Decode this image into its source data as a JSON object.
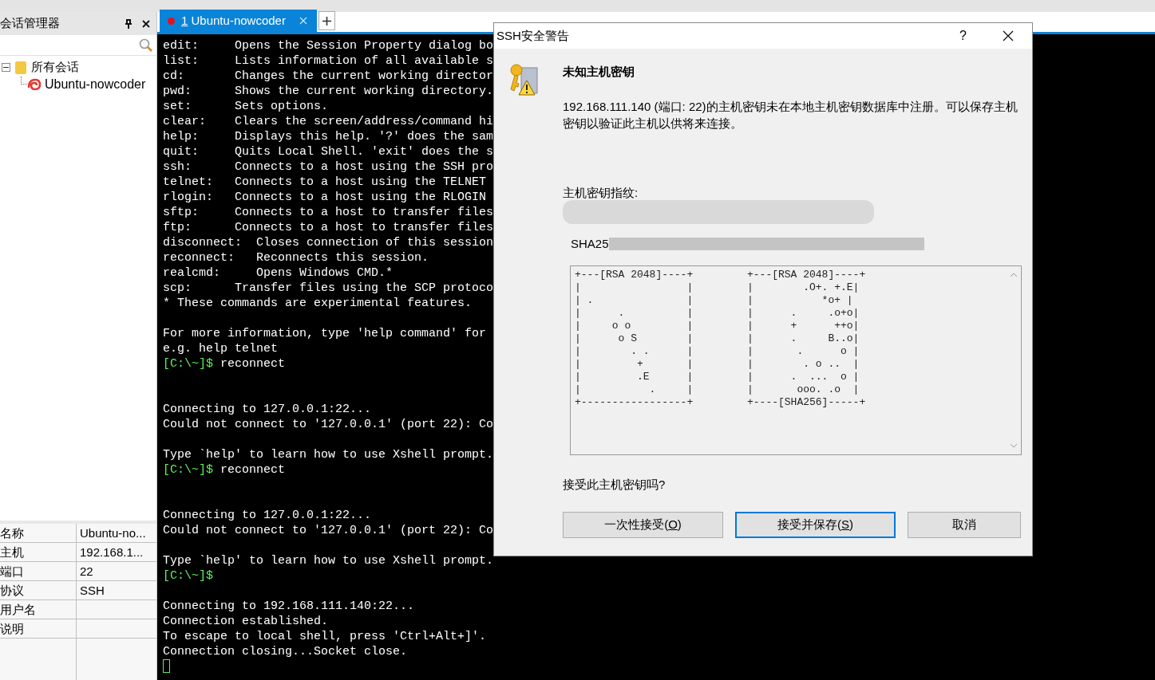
{
  "session_manager": {
    "title": "会话管理器",
    "tree": [
      {
        "label": "所有会话",
        "expanded": true,
        "children": [
          {
            "label": "Ubuntu-nowcoder"
          }
        ]
      }
    ],
    "properties": [
      {
        "name": "名称",
        "value": "Ubuntu-no..."
      },
      {
        "name": "主机",
        "value": "192.168.1..."
      },
      {
        "name": "端口",
        "value": "22"
      },
      {
        "name": "协议",
        "value": "SSH"
      },
      {
        "name": "用户名"
      },
      {
        "name": "说明"
      }
    ]
  },
  "tabs": [
    {
      "number": "1",
      "label": "Ubuntu-nowcoder",
      "selected": true
    }
  ],
  "terminal": {
    "lines": [
      {
        "text": "edit:     Opens the Session Property dialog bo"
      },
      {
        "text": "list:     Lists information of all available s"
      },
      {
        "text": "cd:       Changes the current working director"
      },
      {
        "text": "pwd:      Shows the current working directory."
      },
      {
        "text": "set:      Sets options."
      },
      {
        "text": "clear:    Clears the screen/address/command hi"
      },
      {
        "text": "help:     Displays this help. '?' does the sam"
      },
      {
        "text": "quit:     Quits Local Shell. 'exit' does the s"
      },
      {
        "text": "ssh:      Connects to a host using the SSH pro"
      },
      {
        "text": "telnet:   Connects to a host using the TELNET"
      },
      {
        "text": "rlogin:   Connects to a host using the RLOGIN"
      },
      {
        "text": "sftp:     Connects to a host to transfer files"
      },
      {
        "text": "ftp:      Connects to a host to transfer files"
      },
      {
        "text": "disconnect:  Closes connection of this session"
      },
      {
        "text": "reconnect:   Reconnects this session."
      },
      {
        "text": "realcmd:     Opens Windows CMD.*"
      },
      {
        "text": "scp:      Transfer files using the SCP protoco"
      },
      {
        "text": "* These commands are experimental features."
      },
      {
        "kind": "blank"
      },
      {
        "text": "For more information, type 'help command' for"
      },
      {
        "text": "e.g. help telnet"
      },
      {
        "prompt": "[C:\\~]$",
        "text": " reconnect"
      },
      {
        "kind": "blank"
      },
      {
        "kind": "blank"
      },
      {
        "text": "Connecting to 127.0.0.1:22..."
      },
      {
        "text": "Could not connect to '127.0.0.1' (port 22): Co"
      },
      {
        "kind": "blank"
      },
      {
        "text": "Type `help' to learn how to use Xshell prompt."
      },
      {
        "prompt": "[C:\\~]$",
        "text": " reconnect"
      },
      {
        "kind": "blank"
      },
      {
        "kind": "blank"
      },
      {
        "text": "Connecting to 127.0.0.1:22..."
      },
      {
        "text": "Could not connect to '127.0.0.1' (port 22): Co"
      },
      {
        "kind": "blank"
      },
      {
        "text": "Type `help' to learn how to use Xshell prompt."
      },
      {
        "prompt": "[C:\\~]$"
      },
      {
        "kind": "blank"
      },
      {
        "text": "Connecting to 192.168.111.140:22..."
      },
      {
        "text": "Connection established."
      },
      {
        "text": "To escape to local shell, press 'Ctrl+Alt+]'."
      },
      {
        "text": "Connection closing...Socket close."
      }
    ]
  },
  "dialog": {
    "title": "SSH安全警告",
    "help": "?",
    "heading": "未知主机密钥",
    "message": "192.168.111.140 (端口: 22)的主机密钥未在本地主机密钥数据库中注册。可以保存主机密钥以验证此主机以供将来连接。",
    "fingerprint_label": "主机密钥指纹:",
    "fingerprint": "SHA25",
    "randomart": [
      [
        "+---[RSA 2048]----+",
        "|                 |",
        "| .               |",
        "|      .          |",
        "|     o o         |",
        "|      o S        |",
        "|        . .      |",
        "|         +       |",
        "|         .E      |",
        "|           .     |",
        "+-----------------+"
      ],
      [
        "+---[RSA 2048]----+",
        "|        .O+. +.E|",
        "|           *o+ |",
        "|      .     .o+o|",
        "|      +      ++o|",
        "|      .     B..o|",
        "|       .      o |",
        "|        . o ..  |",
        "|      .  ...  o |",
        "|       ooo. .o  |",
        "+----[SHA256]-----+"
      ]
    ],
    "question": "接受此主机密钥吗?",
    "buttons": [
      {
        "before": "一次性接受(",
        "key": "O",
        "after": ")",
        "default": false
      },
      {
        "before": "接受并保存(",
        "key": "S",
        "after": ")",
        "default": true
      },
      {
        "before": "取消",
        "default": false
      }
    ]
  }
}
